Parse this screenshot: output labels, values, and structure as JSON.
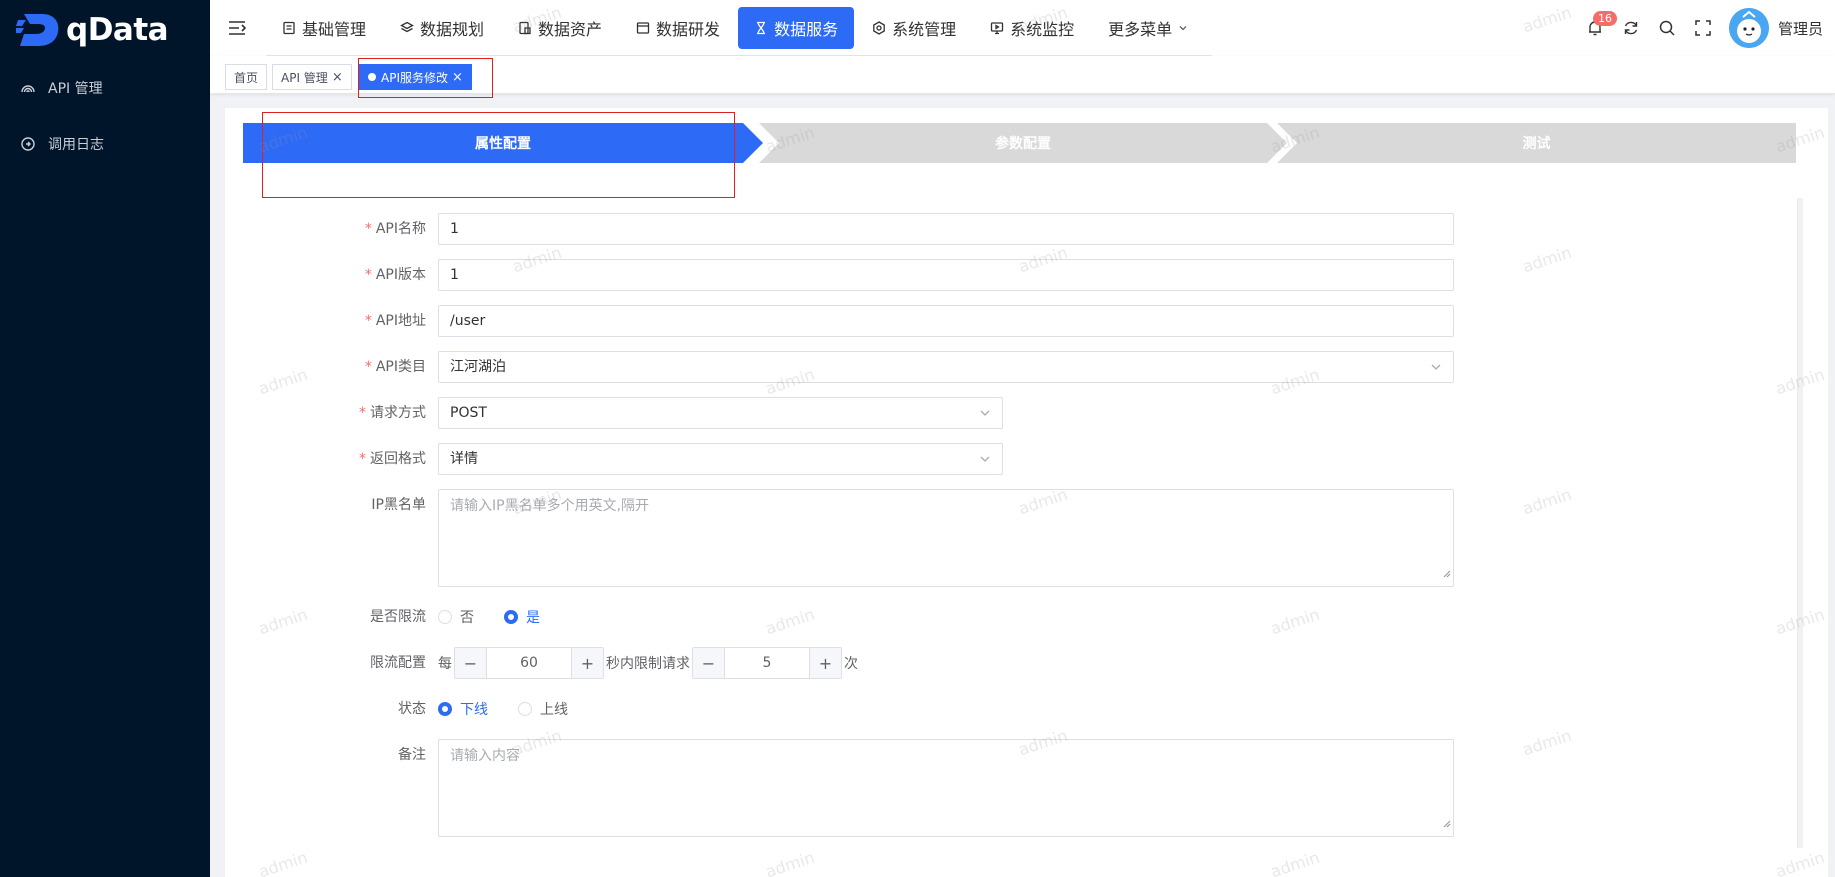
{
  "sidebar": {
    "logo_text": "qData",
    "items": [
      {
        "label": "API 管理",
        "icon": "api-icon"
      },
      {
        "label": "调用日志",
        "icon": "log-icon"
      }
    ]
  },
  "topnav": {
    "items": [
      {
        "label": "基础管理",
        "icon": "base-manage-icon"
      },
      {
        "label": "数据规划",
        "icon": "layers-icon"
      },
      {
        "label": "数据资产",
        "icon": "asset-icon"
      },
      {
        "label": "数据研发",
        "icon": "window-icon"
      },
      {
        "label": "数据服务",
        "icon": "hourglass-icon",
        "active": true
      },
      {
        "label": "系统管理",
        "icon": "settings-icon"
      },
      {
        "label": "系统监控",
        "icon": "monitor-icon"
      },
      {
        "label": "更多菜单",
        "icon": "chevron-down-icon"
      }
    ],
    "notification_count": "16",
    "username": "管理员"
  },
  "tags": [
    {
      "label": "首页"
    },
    {
      "label": "API 管理"
    },
    {
      "label": "API服务修改",
      "active": true
    }
  ],
  "steps": [
    {
      "label": "属性配置",
      "active": true
    },
    {
      "label": "参数配置"
    },
    {
      "label": "测试"
    }
  ],
  "form": {
    "api_name": {
      "label": "API名称",
      "value": "1"
    },
    "api_version": {
      "label": "API版本",
      "value": "1"
    },
    "api_path": {
      "label": "API地址",
      "value": "/user"
    },
    "api_category": {
      "label": "API类目",
      "value": "江河湖泊"
    },
    "request_method": {
      "label": "请求方式",
      "value": "POST"
    },
    "return_format": {
      "label": "返回格式",
      "value": "详情"
    },
    "ip_blacklist": {
      "label": "IP黑名单",
      "placeholder": "请输入IP黑名单多个用英文,隔开"
    },
    "rate_limit": {
      "label": "是否限流",
      "options": [
        "否",
        "是"
      ],
      "selected": "是"
    },
    "limit_config": {
      "label": "限流配置",
      "prefix": "每",
      "seconds": "60",
      "middle": "秒内限制请求",
      "count": "5",
      "suffix": "次"
    },
    "status": {
      "label": "状态",
      "options": [
        "下线",
        "上线"
      ],
      "selected": "下线"
    },
    "remark": {
      "label": "备注",
      "placeholder": "请输入内容"
    }
  },
  "watermark_text": "admin",
  "colors": {
    "primary": "#2d6bf7",
    "sidebar": "#001529",
    "required": "#f56c6c",
    "highlight_box": "#e02020"
  }
}
